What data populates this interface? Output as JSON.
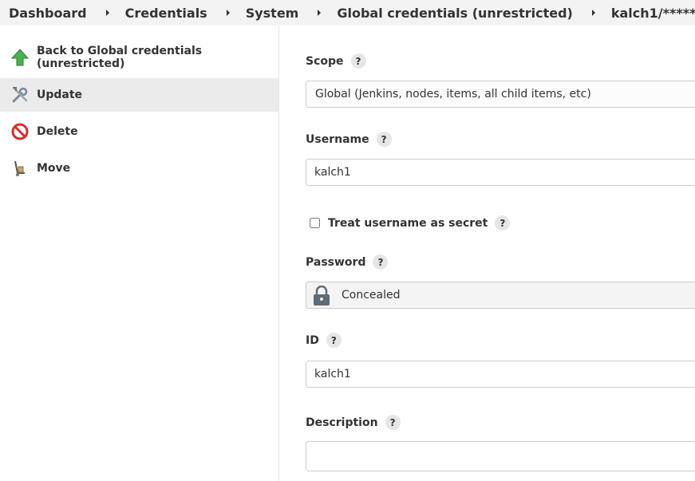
{
  "breadcrumb": {
    "items": [
      "Dashboard",
      "Credentials",
      "System",
      "Global credentials (unrestricted)",
      "kalch1/******"
    ]
  },
  "sidebar": {
    "items": [
      {
        "label": "Back to Global credentials (unrestricted)",
        "icon": "up-arrow-icon"
      },
      {
        "label": "Update",
        "icon": "tools-icon"
      },
      {
        "label": "Delete",
        "icon": "no-entry-icon"
      },
      {
        "label": "Move",
        "icon": "hand-truck-icon"
      }
    ]
  },
  "form": {
    "scope": {
      "label": "Scope",
      "help": "?",
      "value": "Global (Jenkins, nodes, items, all child items, etc)"
    },
    "username": {
      "label": "Username",
      "help": "?",
      "value": "kalch1"
    },
    "treat_secret": {
      "label": "Treat username as secret",
      "help": "?",
      "checked": false
    },
    "password": {
      "label": "Password",
      "help": "?",
      "value": "Concealed"
    },
    "id": {
      "label": "ID",
      "help": "?",
      "value": "kalch1"
    },
    "description": {
      "label": "Description",
      "help": "?",
      "value": ""
    }
  },
  "colors": {
    "breadcrumb_bg": "#f3f3f3",
    "active_item_bg": "#ebebeb",
    "arrow_green": "#4caf50",
    "delete_red": "#d32f2f"
  }
}
